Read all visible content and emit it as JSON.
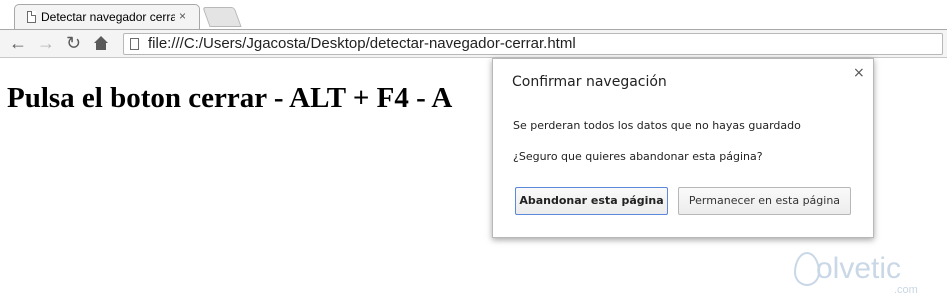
{
  "browser": {
    "tab_title": "Detectar navegador cerrar",
    "tab_close": "×",
    "nav": {
      "back": "←",
      "forward": "→",
      "reload": "↻"
    },
    "url": "file:///C:/Users/Jgacosta/Desktop/detectar-navegador-cerrar.html"
  },
  "page": {
    "heading": "Pulsa el boton cerrar - ALT + F4 - A"
  },
  "dialog": {
    "title": "Confirmar navegación",
    "close": "×",
    "message": "Se perderan todos los datos que no hayas guardado",
    "question": "¿Seguro que quieres abandonar esta página?",
    "leave_button": "Abandonar esta página",
    "stay_button": "Permanecer en esta página",
    "accent_color": "#5b88d9"
  },
  "watermark": {
    "brand": "olvetic",
    "domain": ".com"
  }
}
